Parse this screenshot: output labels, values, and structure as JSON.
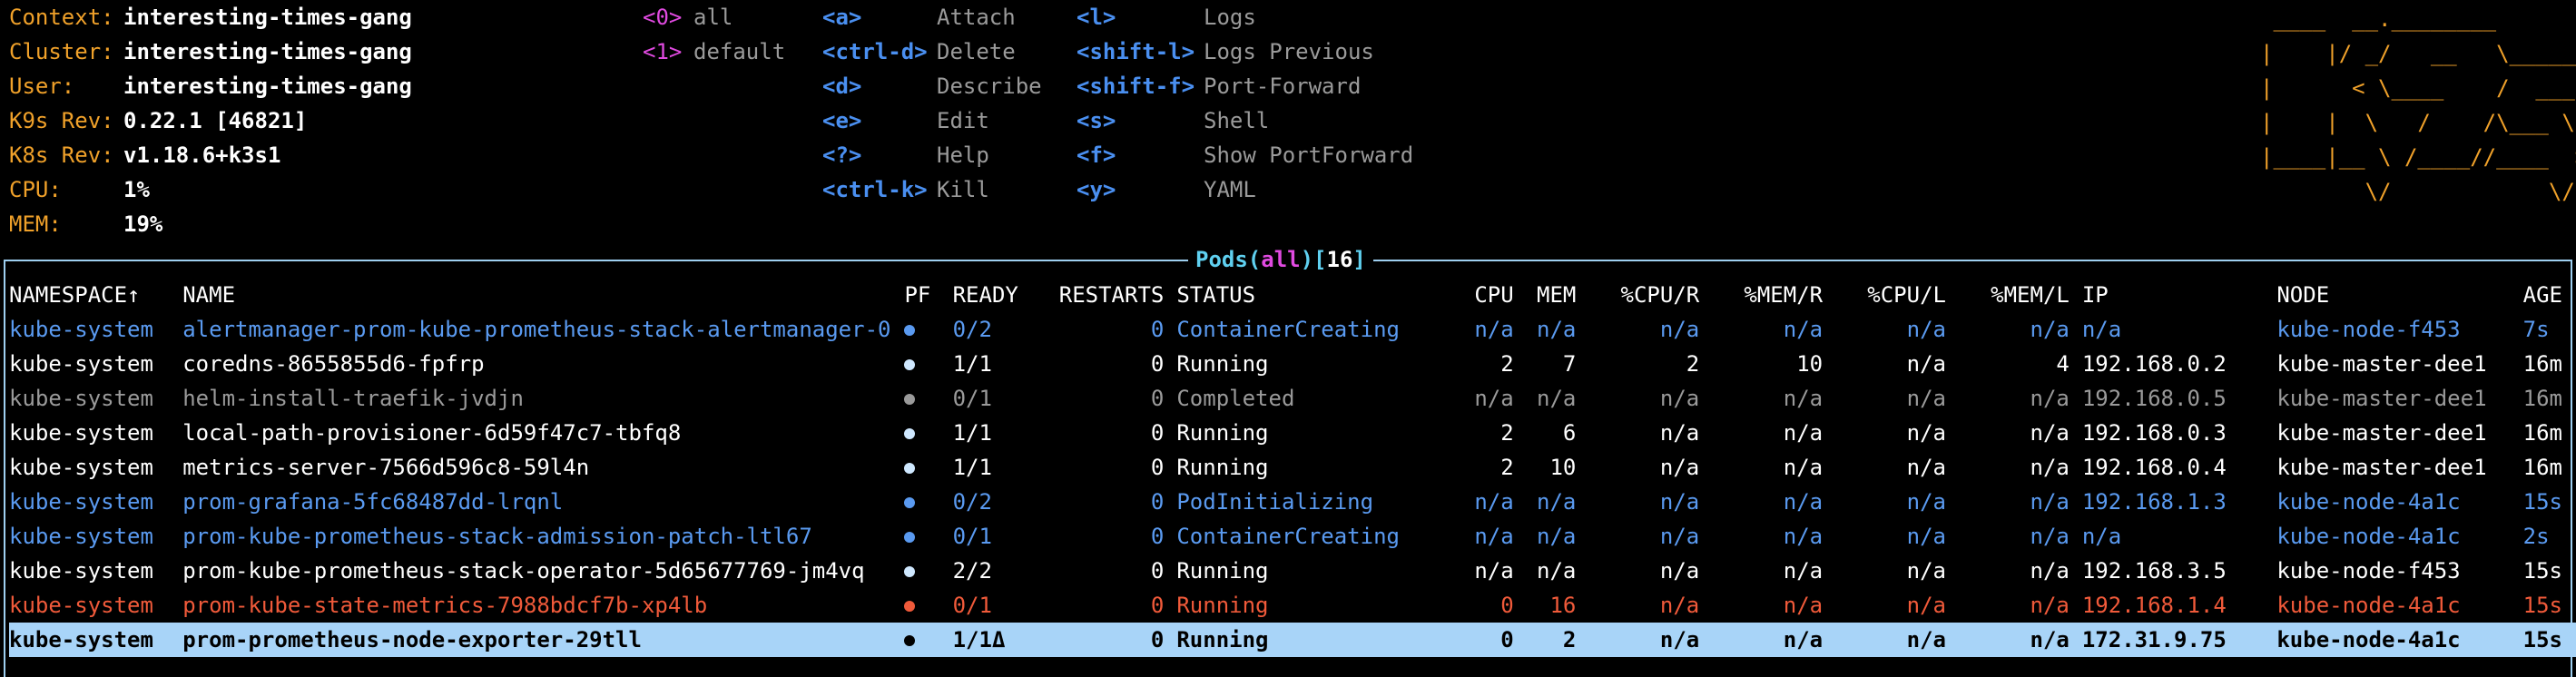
{
  "context": [
    {
      "label": "Context:",
      "value": "interesting-times-gang"
    },
    {
      "label": "Cluster:",
      "value": "interesting-times-gang"
    },
    {
      "label": "User:",
      "value": "interesting-times-gang"
    },
    {
      "label": "K9s Rev:",
      "value": "0.22.1 [46821]"
    },
    {
      "label": "K8s Rev:",
      "value": "v1.18.6+k3s1"
    },
    {
      "label": "CPU:",
      "value": "1%"
    },
    {
      "label": "MEM:",
      "value": "19%"
    }
  ],
  "namespaces": [
    {
      "key": "<0>",
      "label": "all"
    },
    {
      "key": "<1>",
      "label": "default"
    }
  ],
  "hotkeys1": [
    {
      "key": "<a>",
      "label": "Attach"
    },
    {
      "key": "<ctrl-d>",
      "label": "Delete"
    },
    {
      "key": "<d>",
      "label": "Describe"
    },
    {
      "key": "<e>",
      "label": "Edit"
    },
    {
      "key": "<?>",
      "label": "Help"
    },
    {
      "key": "<ctrl-k>",
      "label": "Kill"
    }
  ],
  "hotkeys2": [
    {
      "key": "<l>",
      "label": "Logs"
    },
    {
      "key": "<shift-l>",
      "label": "Logs Previous"
    },
    {
      "key": "<shift-f>",
      "label": "Port-Forward"
    },
    {
      "key": "<s>",
      "label": "Shell"
    },
    {
      "key": "<f>",
      "label": "Show PortForward"
    },
    {
      "key": "<y>",
      "label": "YAML"
    }
  ],
  "logo": [
    " ____  __.________",
    "|    |/ _/   __   \\______",
    "|      < \\____    /  ___/",
    "|    |  \\   /    /\\___ \\",
    "|____|__ \\ /____//____  >",
    "        \\/            \\/"
  ],
  "pods_title": {
    "name": "Pods",
    "ns": "all",
    "count": "16"
  },
  "columns": [
    "NAMESPACE↑",
    "NAME",
    "PF",
    "READY",
    "RESTARTS",
    "STATUS",
    "CPU",
    "MEM",
    "%CPU/R",
    "%MEM/R",
    "%CPU/L",
    "%MEM/L",
    "IP",
    "NODE",
    "AGE"
  ],
  "pods": [
    {
      "style": "blue",
      "ns": "kube-system",
      "name": "alertmanager-prom-kube-prometheus-stack-alertmanager-0",
      "pf": "#5a9af0",
      "ready": "0/2",
      "restarts": "0",
      "status": "ContainerCreating",
      "cpu": "n/a",
      "mem": "n/a",
      "cpur": "n/a",
      "memr": "n/a",
      "cpul": "n/a",
      "meml": "n/a",
      "ip": "n/a",
      "node": "kube-node-f453",
      "age": "7s"
    },
    {
      "style": "white",
      "ns": "kube-system",
      "name": "coredns-8655855d6-fpfrp",
      "pf": "#cfe8ff",
      "ready": "1/1",
      "restarts": "0",
      "status": "Running",
      "cpu": "2",
      "mem": "7",
      "cpur": "2",
      "memr": "10",
      "cpul": "n/a",
      "meml": "4",
      "ip": "192.168.0.2",
      "node": "kube-master-dee1",
      "age": "16m"
    },
    {
      "style": "gray",
      "ns": "kube-system",
      "name": "helm-install-traefik-jvdjn",
      "pf": "#9a9a9a",
      "ready": "0/1",
      "restarts": "0",
      "status": "Completed",
      "cpu": "n/a",
      "mem": "n/a",
      "cpur": "n/a",
      "memr": "n/a",
      "cpul": "n/a",
      "meml": "n/a",
      "ip": "192.168.0.5",
      "node": "kube-master-dee1",
      "age": "16m"
    },
    {
      "style": "white",
      "ns": "kube-system",
      "name": "local-path-provisioner-6d59f47c7-tbfq8",
      "pf": "#cfe8ff",
      "ready": "1/1",
      "restarts": "0",
      "status": "Running",
      "cpu": "2",
      "mem": "6",
      "cpur": "n/a",
      "memr": "n/a",
      "cpul": "n/a",
      "meml": "n/a",
      "ip": "192.168.0.3",
      "node": "kube-master-dee1",
      "age": "16m"
    },
    {
      "style": "white",
      "ns": "kube-system",
      "name": "metrics-server-7566d596c8-59l4n",
      "pf": "#cfe8ff",
      "ready": "1/1",
      "restarts": "0",
      "status": "Running",
      "cpu": "2",
      "mem": "10",
      "cpur": "n/a",
      "memr": "n/a",
      "cpul": "n/a",
      "meml": "n/a",
      "ip": "192.168.0.4",
      "node": "kube-master-dee1",
      "age": "16m"
    },
    {
      "style": "blue",
      "ns": "kube-system",
      "name": "prom-grafana-5fc68487dd-lrqnl",
      "pf": "#5a9af0",
      "ready": "0/2",
      "restarts": "0",
      "status": "PodInitializing",
      "cpu": "n/a",
      "mem": "n/a",
      "cpur": "n/a",
      "memr": "n/a",
      "cpul": "n/a",
      "meml": "n/a",
      "ip": "192.168.1.3",
      "node": "kube-node-4a1c",
      "age": "15s"
    },
    {
      "style": "blue",
      "ns": "kube-system",
      "name": "prom-kube-prometheus-stack-admission-patch-ltl67",
      "pf": "#5a9af0",
      "ready": "0/1",
      "restarts": "0",
      "status": "ContainerCreating",
      "cpu": "n/a",
      "mem": "n/a",
      "cpur": "n/a",
      "memr": "n/a",
      "cpul": "n/a",
      "meml": "n/a",
      "ip": "n/a",
      "node": "kube-node-4a1c",
      "age": "2s"
    },
    {
      "style": "white",
      "ns": "kube-system",
      "name": "prom-kube-prometheus-stack-operator-5d65677769-jm4vq",
      "pf": "#cfe8ff",
      "ready": "2/2",
      "restarts": "0",
      "status": "Running",
      "cpu": "n/a",
      "mem": "n/a",
      "cpur": "n/a",
      "memr": "n/a",
      "cpul": "n/a",
      "meml": "n/a",
      "ip": "192.168.3.5",
      "node": "kube-node-f453",
      "age": "15s"
    },
    {
      "style": "red",
      "ns": "kube-system",
      "name": "prom-kube-state-metrics-7988bdcf7b-xp4lb",
      "pf": "#f05a3a",
      "ready": "0/1",
      "restarts": "0",
      "status": "Running",
      "cpu": "0",
      "mem": "16",
      "cpur": "n/a",
      "memr": "n/a",
      "cpul": "n/a",
      "meml": "n/a",
      "ip": "192.168.1.4",
      "node": "kube-node-4a1c",
      "age": "15s"
    },
    {
      "style": "sel",
      "ns": "kube-system",
      "name": "prom-prometheus-node-exporter-29tll",
      "pf": "#000000",
      "ready": "1/1Δ",
      "restarts": "0",
      "status": "Running",
      "cpu": "0",
      "mem": "2",
      "cpur": "n/a",
      "memr": "n/a",
      "cpul": "n/a",
      "meml": "n/a",
      "ip": "172.31.9.75",
      "node": "kube-node-4a1c",
      "age": "15s"
    }
  ]
}
